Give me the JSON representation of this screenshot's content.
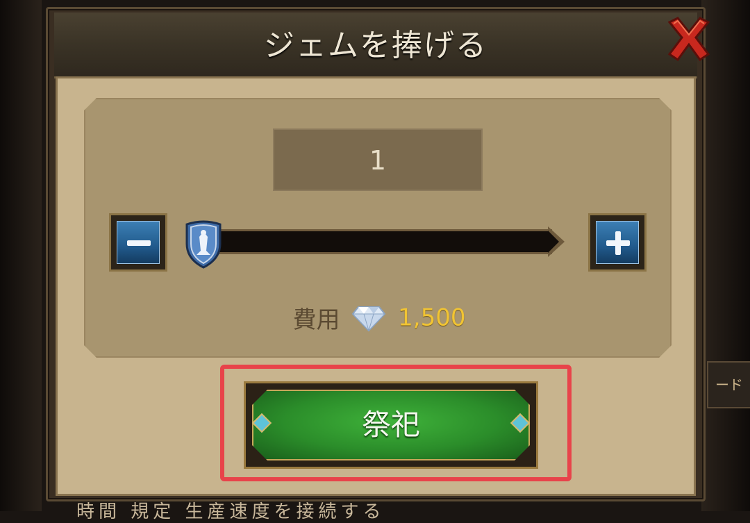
{
  "dialog": {
    "title": "ジェムを捧げる",
    "quantity": "1",
    "cost_label": "費用",
    "cost_value": "1,500",
    "offer_button_label": "祭祀",
    "slider_fraction": 0
  },
  "background": {
    "side_tab_text": "ード",
    "bottom_text": "時間 規定 生産速度を接続する"
  },
  "colors": {
    "accent_highlight": "#e8434a",
    "cost_value": "#f1c433",
    "offer_button_green": "#2b8d2a"
  }
}
